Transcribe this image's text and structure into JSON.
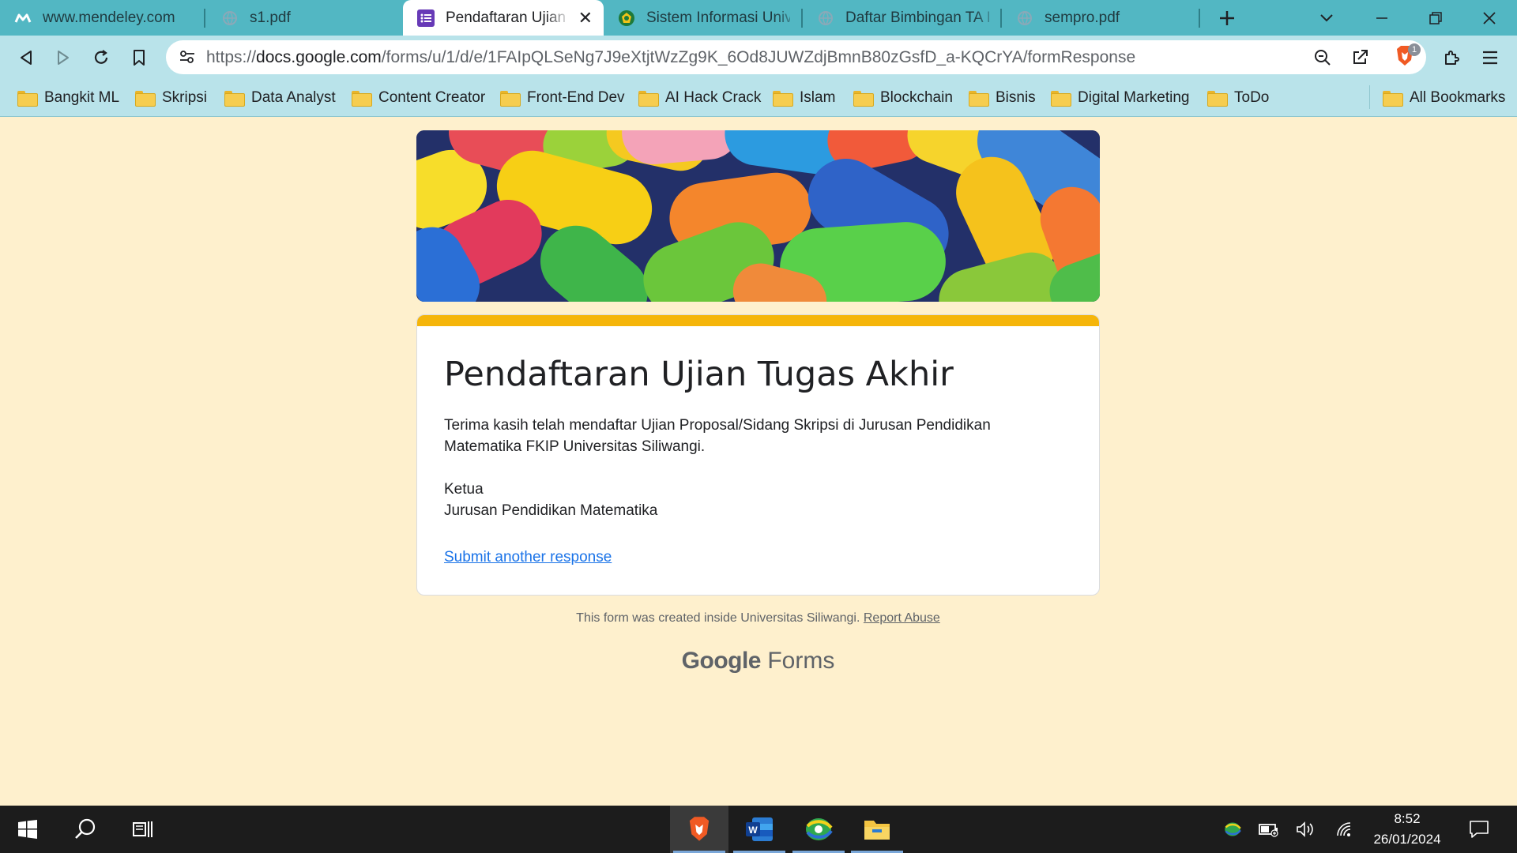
{
  "browser": {
    "tabs": [
      {
        "title": "www.mendeley.com",
        "icon": "mendeley-icon",
        "active": false
      },
      {
        "title": "s1.pdf",
        "icon": "pdf-globe-icon",
        "active": false
      },
      {
        "title": "Pendaftaran Ujian Tugas Akhir",
        "icon": "google-forms-icon",
        "active": true
      },
      {
        "title": "Sistem Informasi Universitas",
        "icon": "university-logo-icon",
        "active": false
      },
      {
        "title": "Daftar Bimbingan TA Mahasiswa",
        "icon": "globe-icon",
        "active": false
      },
      {
        "title": "sempro.pdf",
        "icon": "globe-icon",
        "active": false
      }
    ],
    "url_prefix": "https://",
    "url_domain": "docs.google.com",
    "url_path": "/forms/u/1/d/e/1FAIpQLSeNg7J9eXtjtWzZg9K_6Od8JUWZdjBmnB80zGsfD_a-KQCrYA/formResponse",
    "brave_shield_count": "1",
    "bookmarks": [
      "Bangkit ML",
      "Skripsi",
      "Data Analyst",
      "Content Creator",
      "Front-End Dev",
      "AI Hack Crack",
      "Islam",
      "Blockchain",
      "Bisnis",
      "Digital Marketing",
      "ToDo"
    ],
    "all_bookmarks": "All Bookmarks"
  },
  "form": {
    "title": "Pendaftaran Ujian Tugas Akhir",
    "message": "Terima kasih telah mendaftar Ujian Proposal/Sidang Skripsi di Jurusan Pendidikan\nMatematika FKIP Universitas Siliwangi.\n\nKetua\nJurusan Pendidikan Matematika",
    "submit_another": "Submit another response",
    "footer_text": "This form was created inside Universitas Siliwangi.",
    "report_abuse": "Report Abuse",
    "brand_google": "Google",
    "brand_forms": "Forms",
    "accent_color": "#f5b50a"
  },
  "taskbar": {
    "time": "8:52",
    "date": "26/01/2024"
  }
}
